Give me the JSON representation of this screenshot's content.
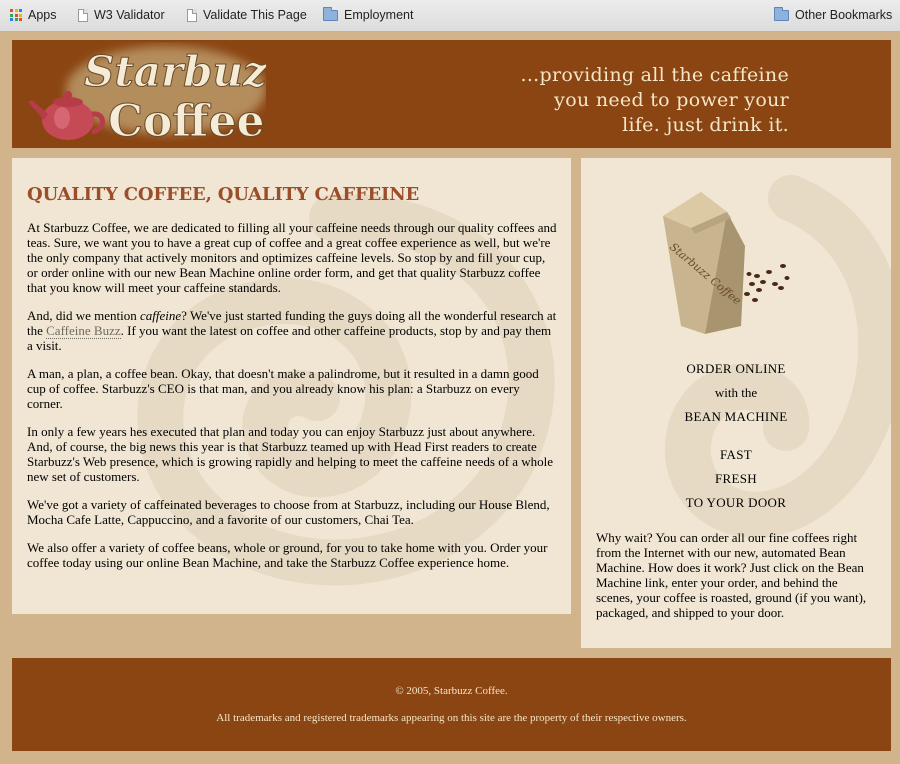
{
  "bookmarks_bar": {
    "items": [
      {
        "label": "Apps",
        "icon": "apps-grid-icon"
      },
      {
        "label": "W3 Validator",
        "icon": "page-icon"
      },
      {
        "label": "Validate This Page",
        "icon": "page-icon"
      },
      {
        "label": "Employment",
        "icon": "folder-icon"
      }
    ],
    "other_bookmarks": {
      "label": "Other Bookmarks",
      "icon": "folder-icon"
    }
  },
  "header": {
    "logo_text_top": "Starbuzz",
    "logo_text_bottom": "Coffee",
    "tagline": [
      "...providing all the caffeine",
      "you need to power your",
      "life. just drink it."
    ]
  },
  "main": {
    "heading": "QUALITY COFFEE, QUALITY CAFFEINE",
    "p1": "At Starbuzz Coffee, we are dedicated to filling all your caffeine needs through our quality coffees and teas. Sure, we want you to have a great cup of coffee and a great coffee experience as well, but we're the only company that actively monitors and optimizes caffeine levels. So stop by and fill your cup, or order online with our new Bean Machine online order form, and get that quality Starbuzz coffee that you know will meet your caffeine standards.",
    "p2_a": "And, did we mention ",
    "p2_em": "caffeine",
    "p2_b": "? We've just started funding the guys doing all the wonderful research at the ",
    "p2_link": "Caffeine Buzz",
    "p2_c": ". If you want the latest on coffee and other caffeine products, stop by and pay them a visit.",
    "p3": "A man, a plan, a coffee bean. Okay, that doesn't make a palindrome, but it resulted in a damn good cup of coffee. Starbuzz's CEO is that man, and you already know his plan: a Starbuzz on every corner.",
    "p4": "In only a few years hes executed that plan and today you can enjoy Starbuzz just about anywhere. And, of course, the big news this year is that Starbuzz teamed up with Head First readers to create Starbuzz's Web presence, which is growing rapidly and helping to meet the caffeine needs of a whole new set of customers.",
    "p5": "We've got a variety of caffeinated beverages to choose from at Starbuzz, including our House Blend, Mocha Cafe Latte, Cappuccino, and a favorite of our customers, Chai Tea.",
    "p6": "We also offer a variety of coffee beans, whole or ground, for you to take home with you. Order your coffee today using our online Bean Machine, and take the Starbuzz Coffee experience home."
  },
  "sidebar": {
    "bag_label": "Starbuzz Coffee",
    "order_online": "ORDER ONLINE",
    "with_the": "with the",
    "bean_machine": "BEAN MACHINE",
    "fast": "FAST",
    "fresh": "FRESH",
    "to_your_door": "TO YOUR DOOR",
    "paragraph": "Why wait? You can order all our fine coffees right from the Internet with our new, automated Bean Machine. How does it work? Just click on the Bean Machine link, enter your order, and behind the scenes, your coffee is roasted, ground (if you want), packaged, and shipped to your door."
  },
  "footer": {
    "copyright": "© 2005, Starbuzz Coffee.",
    "legal": "All trademarks and registered trademarks appearing on this site are the property of their respective owners."
  },
  "colors": {
    "page_bg": "#d2b48c",
    "brand_brown": "#8a4512",
    "panel_bg": "#f0e6d3",
    "heading": "#9c4e2b",
    "tagline_text": "#f5e6c8"
  }
}
